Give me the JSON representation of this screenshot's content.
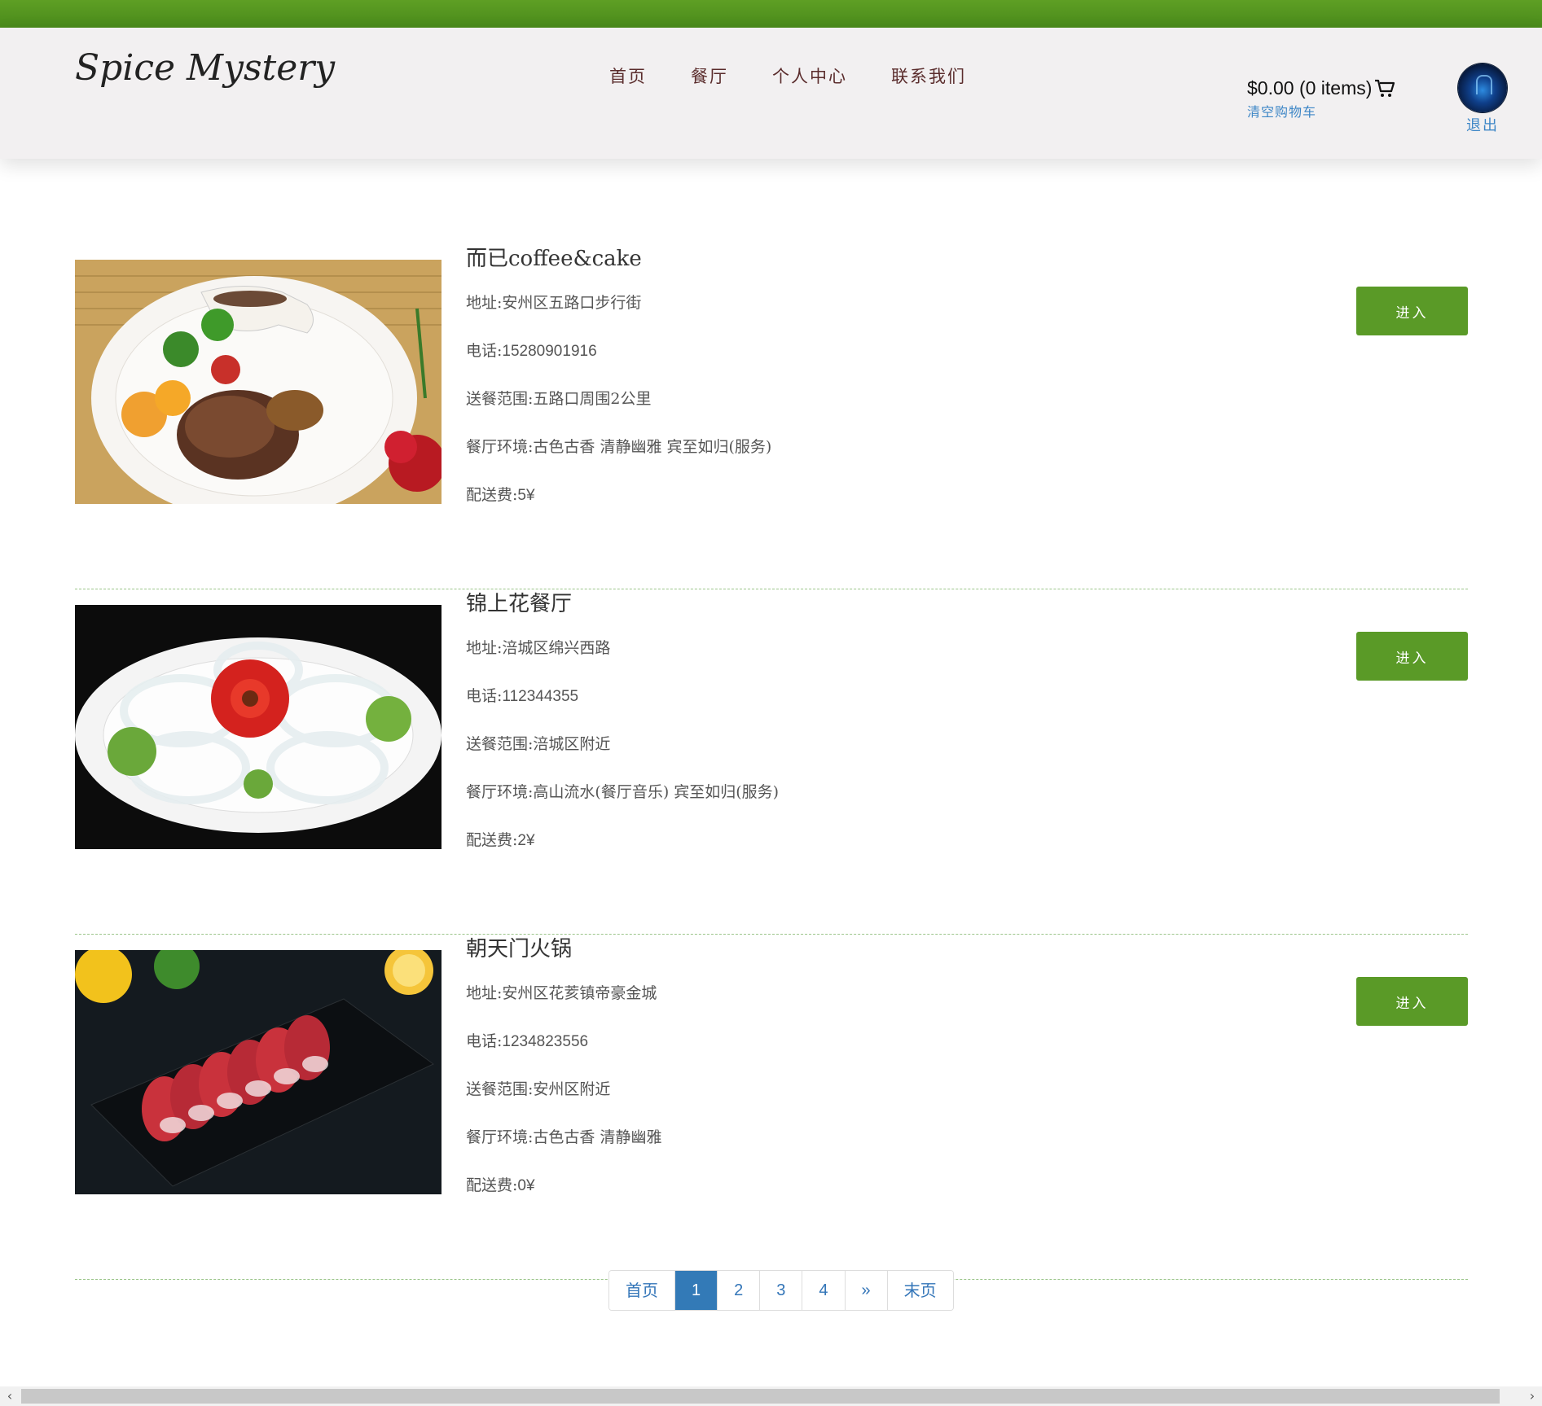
{
  "header": {
    "logo": "Spice Mystery",
    "nav": [
      "首页",
      "餐厅",
      "个人中心",
      "联系我们"
    ],
    "cart_summary": "$0.00 (0 items)",
    "cart_clear": "清空购物车",
    "logout": "退出"
  },
  "restaurants": [
    {
      "name": "而已coffee&cake",
      "address_label": "地址:",
      "address": "安州区五路口步行街",
      "phone_label": "电话:",
      "phone": "15280901916",
      "range_label": "送餐范围:",
      "range": "五路口周围2公里",
      "env_label": "餐厅环境:",
      "env": "古色古香 清静幽雅 宾至如归(服务)",
      "fee_label": "配送费:",
      "fee": "5¥",
      "enter": "进入",
      "image": "steak-plate-image"
    },
    {
      "name": "锦上花餐厅",
      "address_label": "地址:",
      "address": "涪城区绵兴西路",
      "phone_label": "电话:",
      "phone": "112344355",
      "range_label": "送餐范围:",
      "range": "涪城区附近",
      "env_label": "餐厅环境:",
      "env": "高山流水(餐厅音乐) 宾至如归(服务)",
      "fee_label": "配送费:",
      "fee": "2¥",
      "enter": "进入",
      "image": "noodle-plate-image"
    },
    {
      "name": "朝天门火锅",
      "address_label": "地址:",
      "address": "安州区花荄镇帝豪金城",
      "phone_label": "电话:",
      "phone": "1234823556",
      "range_label": "送餐范围:",
      "range": "安州区附近",
      "env_label": "餐厅环境:",
      "env": "古色古香 清静幽雅",
      "fee_label": "配送费:",
      "fee": "0¥",
      "enter": "进入",
      "image": "beef-rolls-image"
    }
  ],
  "pagination": {
    "first": "首页",
    "pages": [
      "1",
      "2",
      "3",
      "4"
    ],
    "current": "1",
    "next": "»",
    "last": "末页"
  },
  "colors": {
    "brand_green": "#5a9a27",
    "pager_active": "#337ab7",
    "link_blue": "#3d86c6"
  }
}
